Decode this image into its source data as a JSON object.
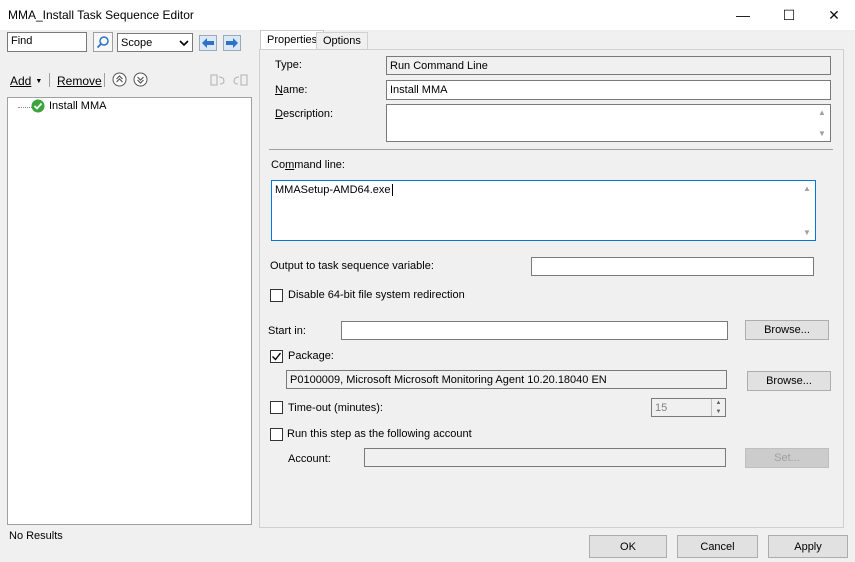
{
  "window": {
    "title": "MMA_Install Task Sequence Editor",
    "minimize": "—",
    "maximize": "☐",
    "close": "✕"
  },
  "toolbar": {
    "find_value": "Find",
    "scope_value": "Scope",
    "add_label": "Add",
    "remove_label": "Remove"
  },
  "tree": {
    "items": [
      {
        "label": "Install MMA",
        "status": "ok"
      }
    ]
  },
  "status_bar": {
    "text": "No Results"
  },
  "tabs": [
    {
      "label": "Properties"
    },
    {
      "label": "Options"
    }
  ],
  "properties": {
    "type_label": "Type:",
    "type_value": "Run Command Line",
    "name_label": "Name:",
    "name_value": "Install MMA",
    "description_label": "Description:",
    "description_value": "",
    "command_line_label": "Command line:",
    "command_line_value": "MMASetup-AMD64.exe",
    "output_var_label": "Output to task sequence variable:",
    "output_var_value": "",
    "disable_redirection_label": "Disable 64-bit file system redirection",
    "disable_redirection_checked": false,
    "start_in_label": "Start in:",
    "start_in_value": "",
    "browse_label": "Browse...",
    "package_label": "Package:",
    "package_checked": true,
    "package_value": "P0100009, Microsoft Microsoft Monitoring Agent 10.20.18040 EN",
    "timeout_label": "Time-out (minutes):",
    "timeout_checked": false,
    "timeout_value": "15",
    "run_as_label": "Run this step as the following account",
    "run_as_checked": false,
    "account_label": "Account:",
    "account_value": "",
    "set_label": "Set..."
  },
  "footer": {
    "ok_label": "OK",
    "cancel_label": "Cancel",
    "apply_label": "Apply"
  },
  "colors": {
    "accent": "#0078d7",
    "nav_arrow": "#2a73c8",
    "success_green": "#3aa53a"
  }
}
